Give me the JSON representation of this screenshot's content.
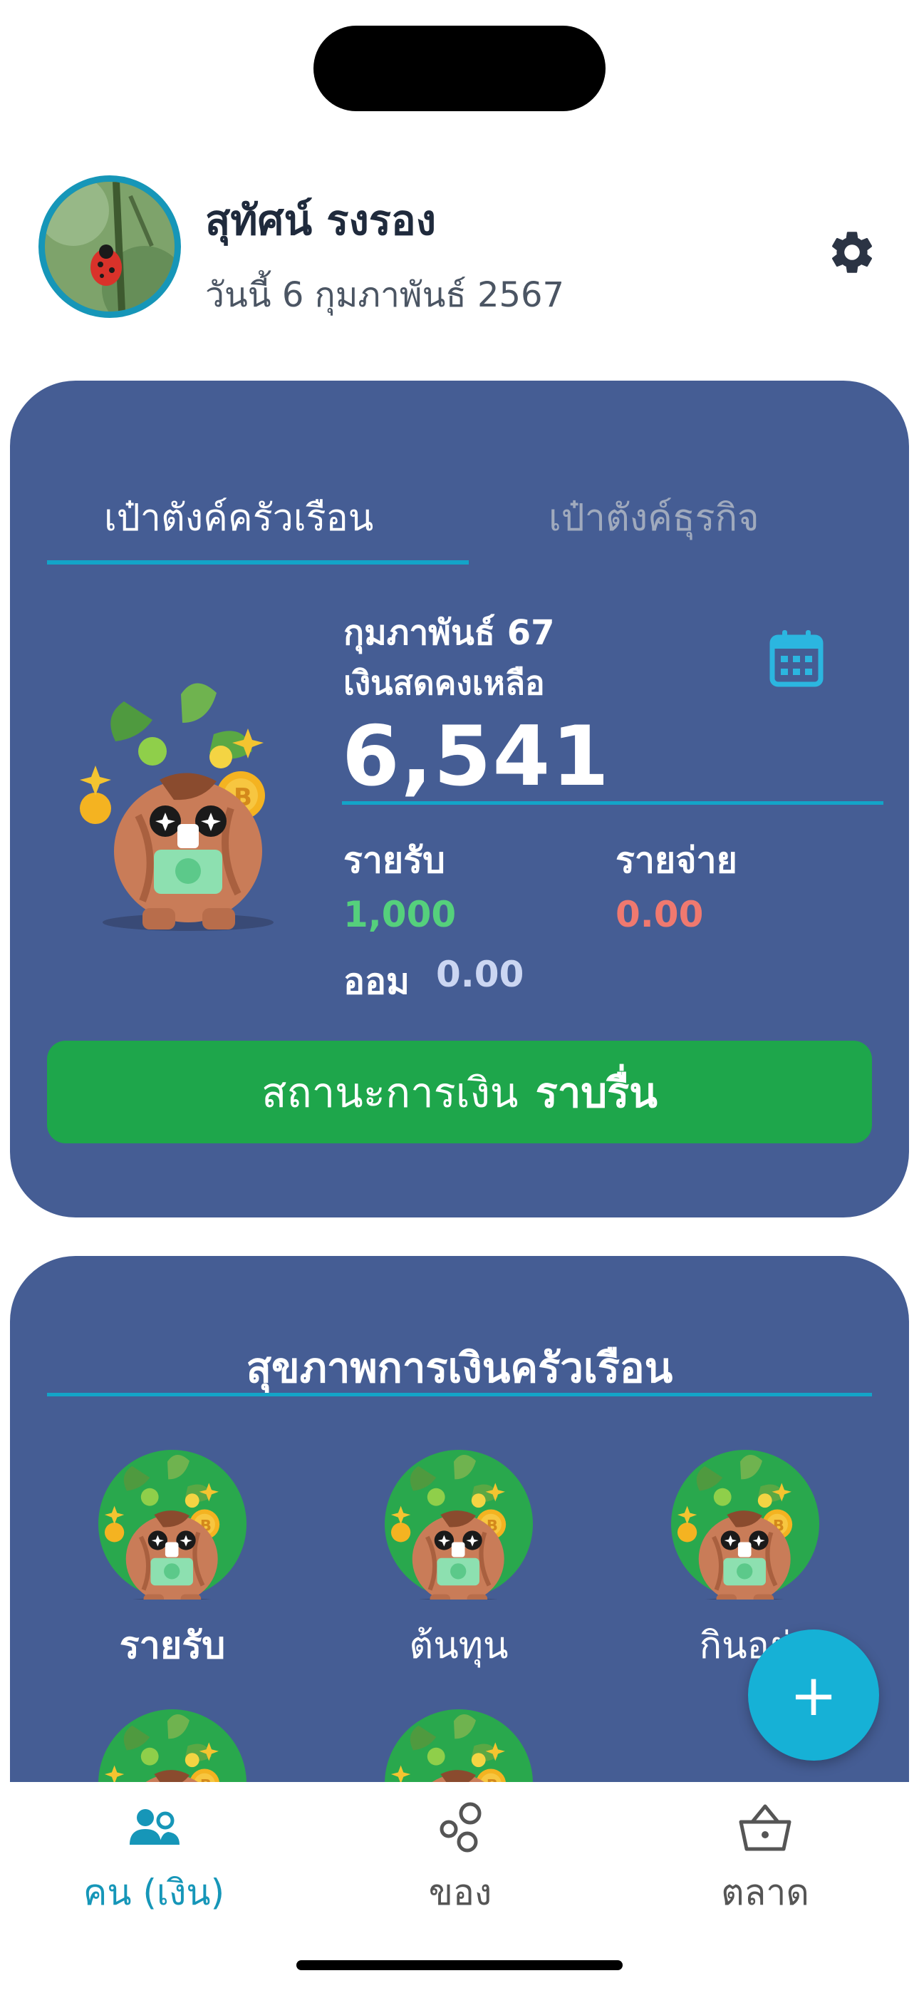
{
  "header": {
    "user_name": "สุทัศน์ รงรอง",
    "date_text": "วันนี้ 6 กุมภาพันธ์ 2567"
  },
  "wallet": {
    "tabs": [
      "เป๋าตังค์ครัวเรือน",
      "เป๋าตังค์ธุรกิจ"
    ],
    "active_tab": 0,
    "month": "กุมภาพันธ์ 67",
    "balance_label": "เงินสดคงเหลือ",
    "balance": "6,541",
    "income_label": "รายรับ",
    "income_value": "1,000",
    "expense_label": "รายจ่าย",
    "expense_value": "0.00",
    "savings_label": "ออม",
    "savings_value": "0.00",
    "status_prefix": "สถานะการเงิน",
    "status_value": "ราบรื่น"
  },
  "health": {
    "title": "สุขภาพการเงินครัวเรือน",
    "items": [
      "รายรับ",
      "ต้นทุน",
      "กินอยู่"
    ]
  },
  "fab": {
    "label": "+"
  },
  "nav": {
    "items": [
      "คน (เงิน)",
      "ของ",
      "ตลาด"
    ],
    "active": 0
  },
  "colors": {
    "card": "#455d94",
    "accent": "#13a4c8",
    "income": "#55d07c",
    "expense": "#f0796f",
    "status_button": "#1ea64b",
    "nav_active": "#1696b8",
    "nav_inactive": "#555555"
  },
  "icons": {
    "settings": "gear-icon",
    "calendar": "calendar-icon",
    "nav": [
      "people-icon",
      "circles-icon",
      "basket-icon"
    ]
  }
}
